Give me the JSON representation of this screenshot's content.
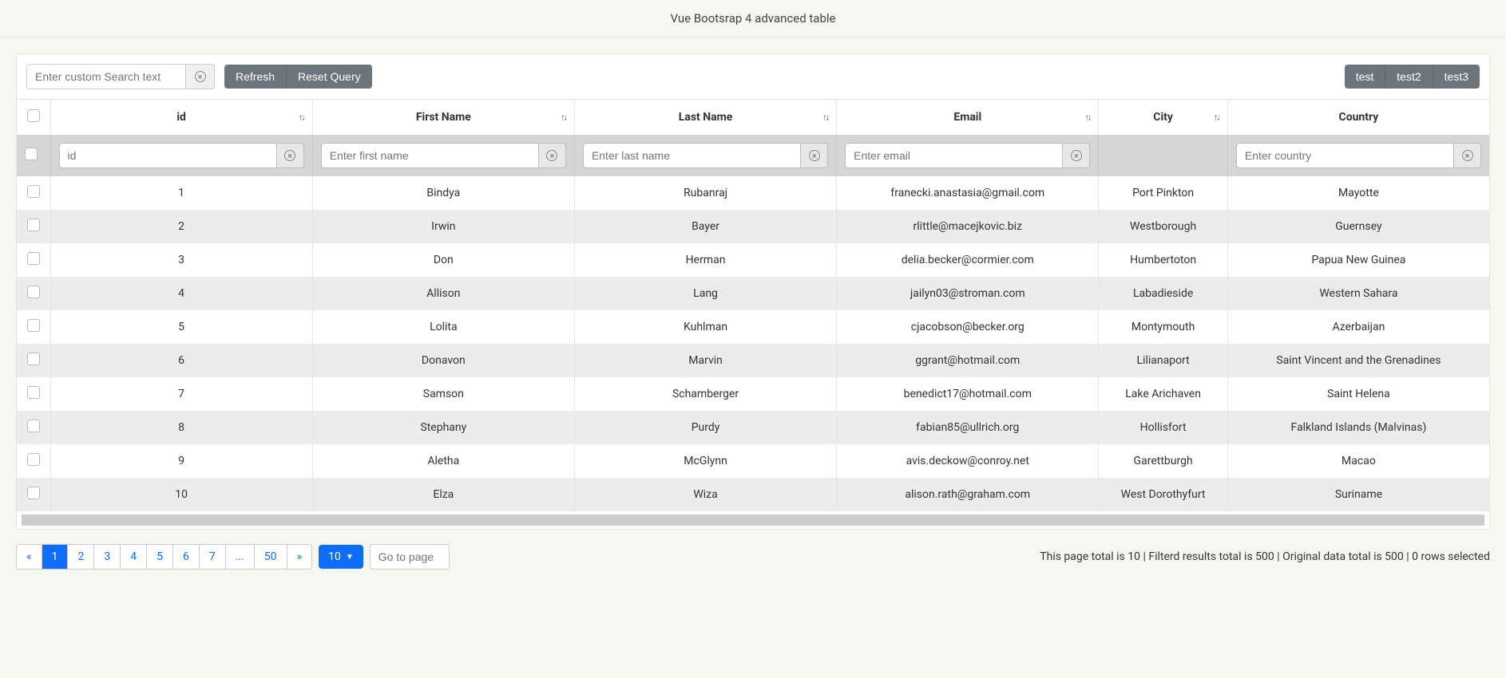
{
  "page_title": "Vue Bootsrap 4 advanced table",
  "toolbar": {
    "search_placeholder": "Enter custom Search text",
    "refresh_label": "Refresh",
    "reset_label": "Reset Query",
    "test_buttons": [
      "test",
      "test2",
      "test3"
    ]
  },
  "columns": [
    {
      "key": "id",
      "label": "id",
      "sortable": true,
      "filter_placeholder": "id",
      "has_filter": true
    },
    {
      "key": "first_name",
      "label": "First Name",
      "sortable": true,
      "filter_placeholder": "Enter first name",
      "has_filter": true
    },
    {
      "key": "last_name",
      "label": "Last Name",
      "sortable": true,
      "filter_placeholder": "Enter last name",
      "has_filter": true
    },
    {
      "key": "email",
      "label": "Email",
      "sortable": true,
      "filter_placeholder": "Enter email",
      "has_filter": true
    },
    {
      "key": "city",
      "label": "City",
      "sortable": true,
      "filter_placeholder": "",
      "has_filter": false
    },
    {
      "key": "country",
      "label": "Country",
      "sortable": false,
      "filter_placeholder": "Enter country",
      "has_filter": true
    }
  ],
  "rows": [
    {
      "id": "1",
      "first_name": "Bindya",
      "last_name": "Rubanraj",
      "email": "franecki.anastasia@gmail.com",
      "city": "Port Pinkton",
      "country": "Mayotte"
    },
    {
      "id": "2",
      "first_name": "Irwin",
      "last_name": "Bayer",
      "email": "rlittle@macejkovic.biz",
      "city": "Westborough",
      "country": "Guernsey"
    },
    {
      "id": "3",
      "first_name": "Don",
      "last_name": "Herman",
      "email": "delia.becker@cormier.com",
      "city": "Humbertoton",
      "country": "Papua New Guinea"
    },
    {
      "id": "4",
      "first_name": "Allison",
      "last_name": "Lang",
      "email": "jailyn03@stroman.com",
      "city": "Labadieside",
      "country": "Western Sahara"
    },
    {
      "id": "5",
      "first_name": "Lolita",
      "last_name": "Kuhlman",
      "email": "cjacobson@becker.org",
      "city": "Montymouth",
      "country": "Azerbaijan"
    },
    {
      "id": "6",
      "first_name": "Donavon",
      "last_name": "Marvin",
      "email": "ggrant@hotmail.com",
      "city": "Lilianaport",
      "country": "Saint Vincent and the Grenadines"
    },
    {
      "id": "7",
      "first_name": "Samson",
      "last_name": "Schamberger",
      "email": "benedict17@hotmail.com",
      "city": "Lake Arichaven",
      "country": "Saint Helena"
    },
    {
      "id": "8",
      "first_name": "Stephany",
      "last_name": "Purdy",
      "email": "fabian85@ullrich.org",
      "city": "Hollisfort",
      "country": "Falkland Islands (Malvinas)"
    },
    {
      "id": "9",
      "first_name": "Aletha",
      "last_name": "McGlynn",
      "email": "avis.deckow@conroy.net",
      "city": "Garettburgh",
      "country": "Macao"
    },
    {
      "id": "10",
      "first_name": "Elza",
      "last_name": "Wiza",
      "email": "alison.rath@graham.com",
      "city": "West Dorothyfurt",
      "country": "Suriname"
    }
  ],
  "pagination": {
    "pages": [
      "«",
      "1",
      "2",
      "3",
      "4",
      "5",
      "6",
      "7",
      "...",
      "50",
      "»"
    ],
    "active_page": "1",
    "page_size": "10",
    "goto_placeholder": "Go to page"
  },
  "footer_status": "This page total is 10 | Filterd results total is 500 | Original data total is 500 | 0 rows selected"
}
